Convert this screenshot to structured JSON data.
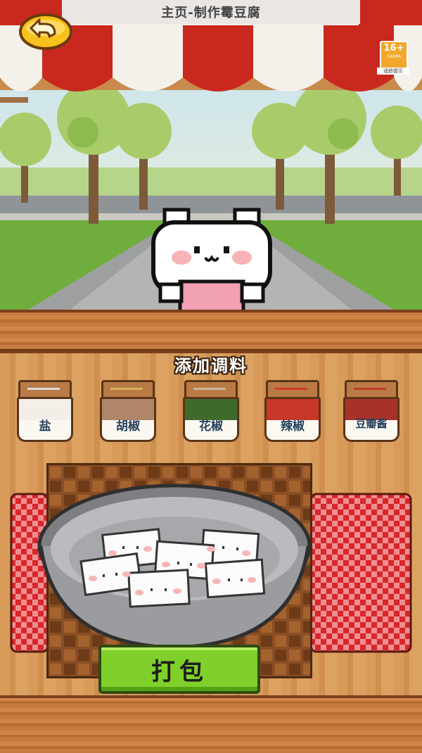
{
  "window": {
    "title": "主页-制作霉豆腐"
  },
  "age_rating": {
    "value": "16+",
    "org": "CADPA",
    "caption": "适龄提示"
  },
  "icons": {
    "back": "back-arrow-icon",
    "mascot": "white-bear-mascot"
  },
  "seasoning": {
    "title": "添加调料",
    "jars": [
      {
        "label": "盐",
        "accent": "#d9d9d9",
        "fill": "#f3efe8"
      },
      {
        "label": "胡椒",
        "accent": "#d6b15c",
        "fill": "#b08668"
      },
      {
        "label": "花椒",
        "accent": "#c9b79a",
        "fill": "#3f6a2c"
      },
      {
        "label": "辣椒",
        "accent": "#d23a2a",
        "fill": "#c7382b"
      },
      {
        "label": "豆瓣酱",
        "accent": "#c13a2b",
        "fill": "#a8322a"
      }
    ]
  },
  "bowl": {
    "tofu_count": 6
  },
  "actions": {
    "pack_label": "打包"
  },
  "colors": {
    "awning_red": "#c8281e",
    "button_green": "#7fd02a",
    "wood": "#d89b5a"
  }
}
